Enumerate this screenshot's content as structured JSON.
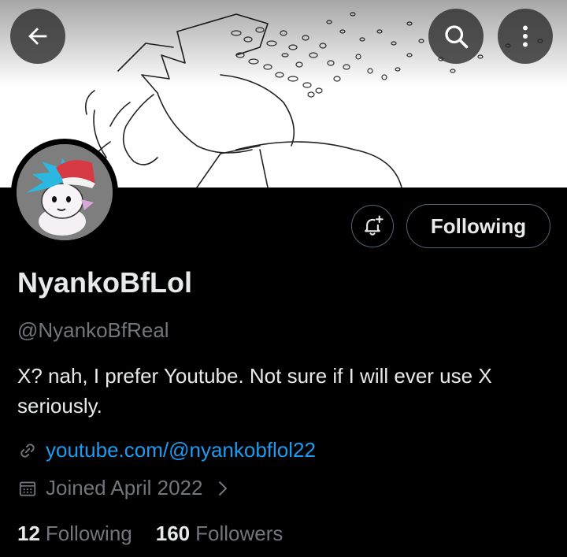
{
  "header": {
    "back_icon": "arrow-left-icon",
    "search_icon": "search-icon",
    "more_icon": "more-vertical-icon"
  },
  "profile": {
    "display_name": "NyankoBfLol",
    "handle": "@NyankoBfReal",
    "bio": "X? nah, I prefer Youtube. Not sure if I will ever use X seriously.",
    "link": "youtube.com/@nyankobflol22",
    "joined": "Joined April 2022"
  },
  "actions": {
    "following_label": "Following",
    "bell_icon": "bell-plus-icon"
  },
  "stats": {
    "following_count": "12",
    "following_label": "Following",
    "followers_count": "160",
    "followers_label": "Followers"
  },
  "colors": {
    "background": "#000000",
    "accent_link": "#1d9bf0",
    "muted_text": "#71767b",
    "primary_text": "#e7e9ea",
    "border": "#536471"
  }
}
